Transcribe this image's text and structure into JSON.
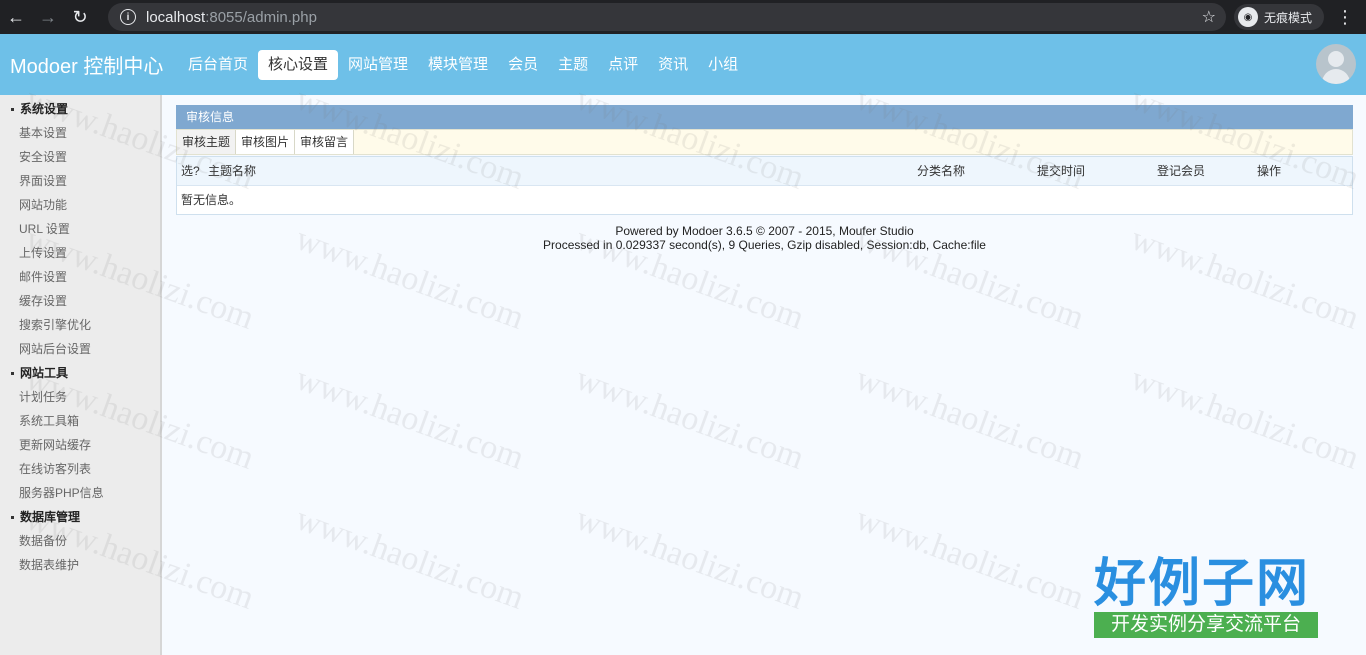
{
  "browser": {
    "url_host": "localhost",
    "url_rest": ":8055/admin.php",
    "incognito_label": "无痕模式"
  },
  "header": {
    "brand": "Modoer 控制中心",
    "nav": [
      {
        "label": "后台首页"
      },
      {
        "label": "核心设置"
      },
      {
        "label": "网站管理"
      },
      {
        "label": "模块管理"
      },
      {
        "label": "会员"
      },
      {
        "label": "主题"
      },
      {
        "label": "点评"
      },
      {
        "label": "资讯"
      },
      {
        "label": "小组"
      }
    ],
    "active_index": 1
  },
  "sidebar": {
    "section1": "系统设置",
    "items1": [
      "基本设置",
      "安全设置",
      "界面设置",
      "网站功能",
      "URL 设置",
      "上传设置",
      "邮件设置",
      "缓存设置",
      "搜索引擎优化",
      "网站后台设置"
    ],
    "section2": "网站工具",
    "items2": [
      "计划任务",
      "系统工具箱",
      "更新网站缓存",
      "在线访客列表",
      "服务器PHP信息"
    ],
    "section3": "数据库管理",
    "items3": [
      "数据备份",
      "数据表维护"
    ]
  },
  "main": {
    "panel_title": "审核信息",
    "subtabs": [
      "审核主题",
      "审核图片",
      "审核留言"
    ],
    "columns": {
      "select": "选?",
      "name": "主题名称",
      "category": "分类名称",
      "submit_time": "提交时间",
      "member": "登记会员",
      "action": "操作"
    },
    "empty_text": "暂无信息。",
    "footer_line1": "Powered by Modoer 3.6.5 © 2007 - 2015, Moufer Studio",
    "footer_line2": "Processed in 0.029337 second(s), 9 Queries, Gzip disabled, Session:db, Cache:file"
  },
  "watermark": {
    "text": "www.haolizi.com",
    "logo_big": "好例子网",
    "logo_small": "开发实例分享交流平台"
  }
}
